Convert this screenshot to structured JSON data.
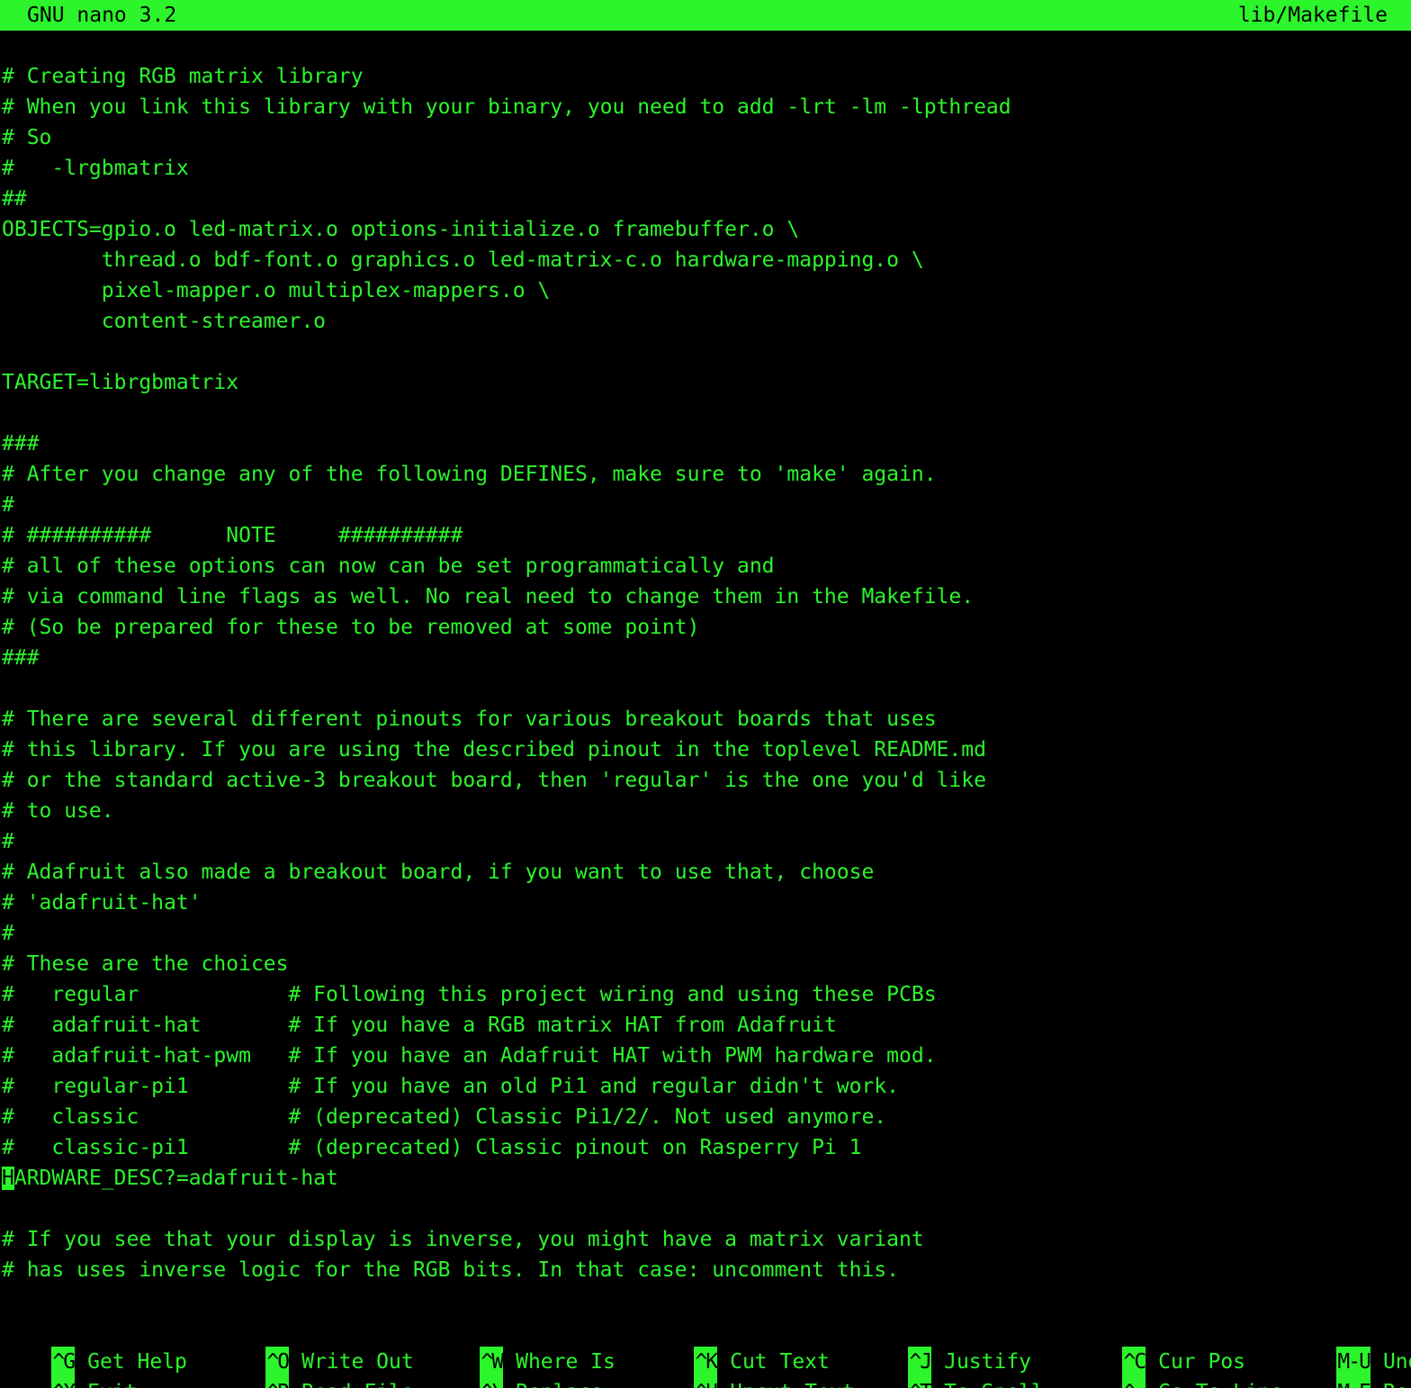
{
  "titlebar": {
    "version": "GNU nano 3.2",
    "filename": "lib/Makefile"
  },
  "editor": {
    "lines": [
      "# Creating RGB matrix library",
      "# When you link this library with your binary, you need to add -lrt -lm -lpthread",
      "# So",
      "#   -lrgbmatrix",
      "##",
      "OBJECTS=gpio.o led-matrix.o options-initialize.o framebuffer.o \\",
      "        thread.o bdf-font.o graphics.o led-matrix-c.o hardware-mapping.o \\",
      "        pixel-mapper.o multiplex-mappers.o \\",
      "        content-streamer.o",
      "",
      "TARGET=librgbmatrix",
      "",
      "###",
      "# After you change any of the following DEFINES, make sure to 'make' again.",
      "#",
      "# ##########      NOTE     ##########",
      "# all of these options can now can be set programmatically and",
      "# via command line flags as well. No real need to change them in the Makefile.",
      "# (So be prepared for these to be removed at some point)",
      "###",
      "",
      "# There are several different pinouts for various breakout boards that uses",
      "# this library. If you are using the described pinout in the toplevel README.md",
      "# or the standard active-3 breakout board, then 'regular' is the one you'd like",
      "# to use.",
      "#",
      "# Adafruit also made a breakout board, if you want to use that, choose",
      "# 'adafruit-hat'",
      "#",
      "# These are the choices",
      "#   regular            # Following this project wiring and using these PCBs",
      "#   adafruit-hat       # If you have a RGB matrix HAT from Adafruit",
      "#   adafruit-hat-pwm   # If you have an Adafruit HAT with PWM hardware mod.",
      "#   regular-pi1        # If you have an old Pi1 and regular didn't work.",
      "#   classic            # (deprecated) Classic Pi1/2/. Not used anymore.",
      "#   classic-pi1        # (deprecated) Classic pinout on Rasperry Pi 1",
      "ARDWARE_DESC?=adafruit-hat",
      "",
      "# If you see that your display is inverse, you might have a matrix variant",
      "# has uses inverse logic for the RGB bits. In that case: uncomment this."
    ],
    "cursor_char": "H"
  },
  "shortcuts": [
    {
      "key": "^G",
      "label": "Get Help"
    },
    {
      "key": "^O",
      "label": "Write Out"
    },
    {
      "key": "^W",
      "label": "Where Is"
    },
    {
      "key": "^K",
      "label": "Cut Text"
    },
    {
      "key": "^J",
      "label": "Justify"
    },
    {
      "key": "^C",
      "label": "Cur Pos"
    },
    {
      "key": "M-U",
      "label": "Undo"
    },
    {
      "key": "^X",
      "label": "Exit"
    },
    {
      "key": "^R",
      "label": "Read File"
    },
    {
      "key": "^\\",
      "label": "Replace"
    },
    {
      "key": "^U",
      "label": "Uncut Text"
    },
    {
      "key": "^T",
      "label": "To Spell"
    },
    {
      "key": "^_",
      "label": "Go To Line"
    },
    {
      "key": "M-E",
      "label": "Redo"
    }
  ],
  "colors": {
    "foreground": "#2cf52c",
    "background": "#000000"
  }
}
